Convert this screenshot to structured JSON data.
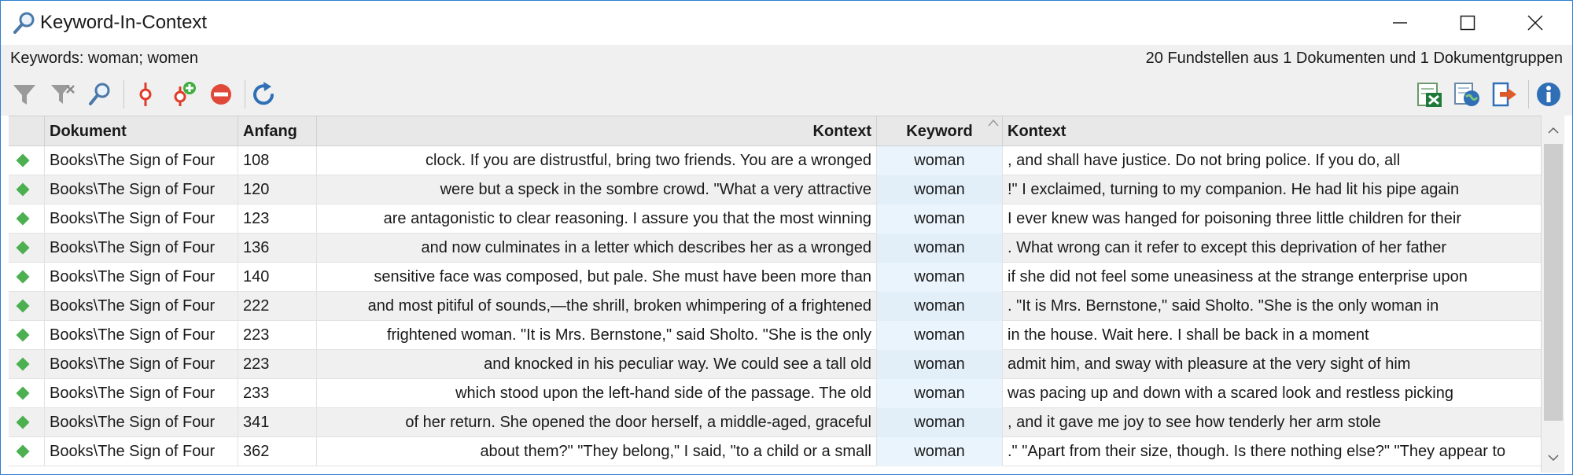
{
  "window": {
    "title": "Keyword-In-Context"
  },
  "info": {
    "keywords": "Keywords: woman; women",
    "summary": "20 Fundstellen aus 1 Dokumenten und 1 Dokumentgruppen"
  },
  "toolbar": {
    "icons": [
      "filter-icon",
      "filter-clear-icon",
      "search-icon",
      "pin-icon",
      "pin-add-icon",
      "remove-icon",
      "refresh-icon",
      "excel-export-icon",
      "web-export-icon",
      "export-icon",
      "info-icon"
    ]
  },
  "table": {
    "columns": [
      "Dokument",
      "Anfang",
      "Kontext",
      "Keyword",
      "Kontext"
    ],
    "rows": [
      {
        "doc": "Books\\The Sign of Four",
        "start": "108",
        "left": "clock. If you are distrustful, bring two friends. You are a wronged",
        "kw": "woman",
        "right": ", and shall have justice. Do not bring police. If you do, all"
      },
      {
        "doc": "Books\\The Sign of Four",
        "start": "120",
        "left": "were but a speck in the sombre crowd.  \"What a very attractive",
        "kw": "woman",
        "right": "!\" I exclaimed, turning to my companion.  He had lit his pipe again"
      },
      {
        "doc": "Books\\The Sign of Four",
        "start": "123",
        "left": "are antagonistic to clear reasoning. I assure you that the most winning",
        "kw": "woman",
        "right": " I ever knew was hanged for poisoning three little children for their"
      },
      {
        "doc": "Books\\The Sign of Four",
        "start": "136",
        "left": "and now culminates in a letter which describes her as a wronged",
        "kw": "woman",
        "right": ". What wrong can it refer to except this deprivation of her father"
      },
      {
        "doc": "Books\\The Sign of Four",
        "start": "140",
        "left": "sensitive face was composed, but pale. She must have been more than",
        "kw": "woman",
        "right": " if she did not feel some uneasiness at the strange enterprise upon"
      },
      {
        "doc": "Books\\The Sign of Four",
        "start": "222",
        "left": "and most pitiful of sounds,—the shrill, broken whimpering of a frightened",
        "kw": "woman",
        "right": ".  \"It is Mrs. Bernstone,\" said Sholto. \"She is the only woman in"
      },
      {
        "doc": "Books\\The Sign of Four",
        "start": "223",
        "left": "frightened woman.  \"It is Mrs. Bernstone,\" said Sholto. \"She is the only",
        "kw": "woman",
        "right": " in the house. Wait here. I shall be back in a moment"
      },
      {
        "doc": "Books\\The Sign of Four",
        "start": "223",
        "left": "and knocked in his peculiar way. We could see a tall old",
        "kw": "woman",
        "right": " admit him, and sway with pleasure at the very sight of him"
      },
      {
        "doc": "Books\\The Sign of Four",
        "start": "233",
        "left": "which stood upon the left-hand side of the passage. The old",
        "kw": "woman",
        "right": " was pacing up and down with a scared look and restless picking"
      },
      {
        "doc": "Books\\The Sign of Four",
        "start": "341",
        "left": "of her return. She opened the door herself, a middle-aged, graceful",
        "kw": "woman",
        "right": ", and it gave me joy to see how tenderly her arm stole"
      },
      {
        "doc": "Books\\The Sign of Four",
        "start": "362",
        "left": "about them?\"  \"They belong,\" I said, \"to a child or a small",
        "kw": "woman",
        "right": ".\"  \"Apart from their size, though. Is there nothing else?\"  \"They appear to"
      }
    ]
  }
}
